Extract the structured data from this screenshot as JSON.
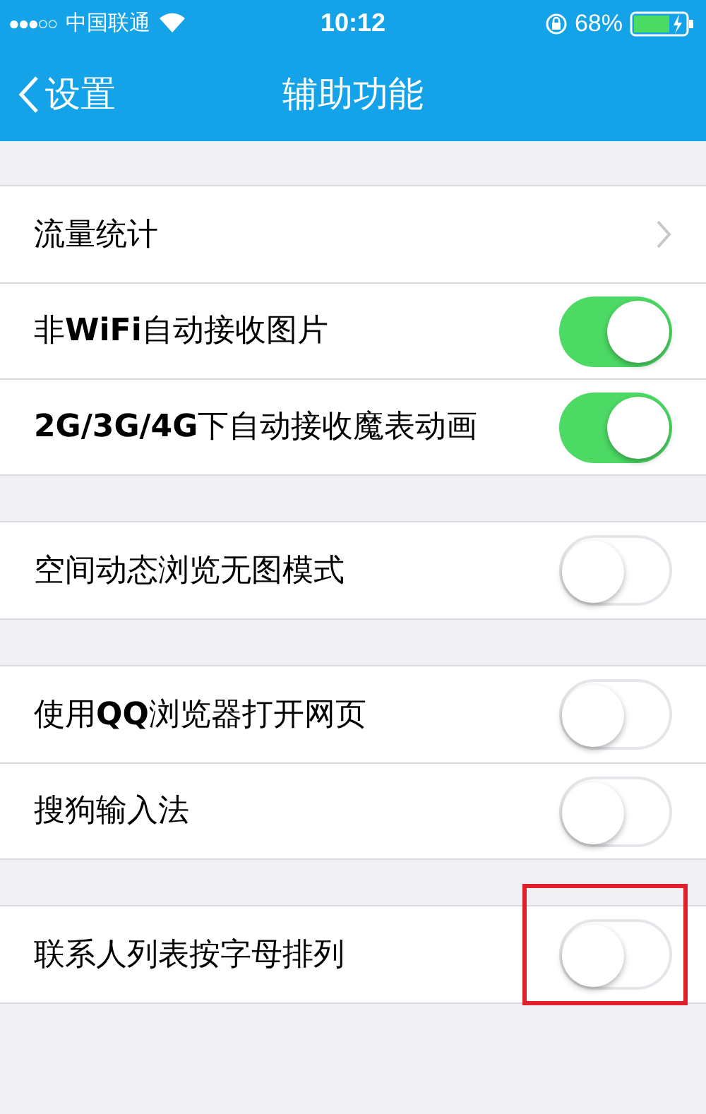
{
  "status_bar": {
    "signal": "●●●○○",
    "carrier": "中国联通",
    "time": "10:12",
    "battery": "68%"
  },
  "nav": {
    "back": "设置",
    "title": "辅助功能"
  },
  "groups": [
    {
      "items": [
        {
          "kind": "link",
          "label": "流量统计"
        },
        {
          "kind": "toggle",
          "label": "非**WiFi**自动接收图片",
          "on": true,
          "highlighted": false
        },
        {
          "kind": "toggle",
          "label": "**2G/3G/4G**下自动接收魔表动画",
          "on": true,
          "highlighted": false
        }
      ]
    },
    {
      "items": [
        {
          "kind": "toggle",
          "label": "空间动态浏览无图模式",
          "on": false,
          "highlighted": false
        }
      ]
    },
    {
      "items": [
        {
          "kind": "toggle",
          "label": "使用**QQ**浏览器打开网页",
          "on": false,
          "highlighted": false
        },
        {
          "kind": "toggle",
          "label": "搜狗输入法",
          "on": false,
          "highlighted": false
        }
      ]
    },
    {
      "items": [
        {
          "kind": "toggle",
          "label": "联系人列表按字母排列",
          "on": false,
          "highlighted": true
        }
      ]
    }
  ]
}
